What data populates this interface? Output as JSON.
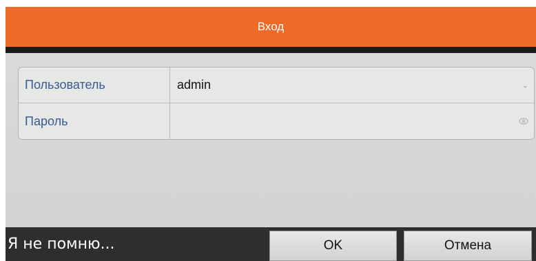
{
  "dialog": {
    "title": "Вход"
  },
  "form": {
    "user_label": "Пользователь",
    "user_value": "admin",
    "user_dropdown_icon": "chevron-down-icon",
    "password_label": "Пароль",
    "password_value": "",
    "password_toggle_icon": "eye-icon"
  },
  "footer": {
    "forgot_label": "Я не помню...",
    "ok_label": "OK",
    "cancel_label": "Отмена"
  },
  "colors": {
    "title_bar": "#ee6a27",
    "label_text": "#3a5a93",
    "footer_bar": "#2e2e2e"
  }
}
